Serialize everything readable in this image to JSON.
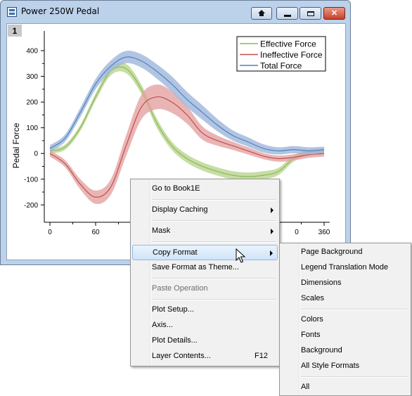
{
  "window": {
    "title": "Power 250W Pedal",
    "layer_number": "1"
  },
  "titlebar_buttons": {
    "home_icon": "home-icon",
    "minimize_icon": "minimize-icon",
    "maximize_icon": "maximize-icon",
    "close_icon": "close-icon"
  },
  "chart_data": {
    "type": "area",
    "ylabel": "Pedal Force",
    "xlabel": "",
    "xlim": [
      0,
      360
    ],
    "ylim": [
      -240,
      430
    ],
    "x_ticks_visible": [
      "0",
      "60",
      "0",
      "360"
    ],
    "y_ticks": [
      "400",
      "300",
      "200",
      "100",
      "0",
      "-100",
      "-200"
    ],
    "legend_position": "top-right",
    "series": [
      {
        "name": "Effective Force",
        "color": "#8db85a",
        "band_color": "#b9d48f",
        "x": [
          0,
          20,
          40,
          60,
          80,
          100,
          120,
          140,
          160,
          180,
          200,
          220,
          240,
          260,
          280,
          300,
          320,
          340,
          360
        ],
        "values": [
          10,
          25,
          100,
          220,
          320,
          330,
          250,
          120,
          30,
          -20,
          -50,
          -70,
          -85,
          -90,
          -85,
          -70,
          -20,
          5,
          10
        ],
        "band_half_width": [
          10,
          10,
          12,
          14,
          16,
          18,
          18,
          18,
          16,
          16,
          16,
          16,
          16,
          16,
          16,
          14,
          12,
          10,
          10
        ]
      },
      {
        "name": "Ineffective Force",
        "color": "#c0504d",
        "band_color": "#e3a3a1",
        "x": [
          0,
          20,
          40,
          60,
          80,
          100,
          120,
          140,
          160,
          180,
          200,
          220,
          240,
          260,
          280,
          300,
          320,
          340,
          360
        ],
        "values": [
          0,
          -40,
          -120,
          -170,
          -130,
          30,
          180,
          220,
          200,
          150,
          80,
          50,
          30,
          10,
          -10,
          -20,
          -15,
          -5,
          0
        ],
        "band_half_width": [
          12,
          14,
          20,
          26,
          30,
          40,
          48,
          48,
          42,
          34,
          26,
          20,
          16,
          14,
          12,
          12,
          12,
          12,
          12
        ]
      },
      {
        "name": "Total Force",
        "color": "#4f81bd",
        "band_color": "#9db7dc",
        "x": [
          0,
          20,
          40,
          60,
          80,
          100,
          120,
          140,
          160,
          180,
          200,
          220,
          240,
          260,
          280,
          300,
          320,
          340,
          360
        ],
        "values": [
          20,
          60,
          160,
          270,
          340,
          375,
          360,
          320,
          270,
          210,
          160,
          110,
          70,
          45,
          20,
          10,
          15,
          10,
          15
        ],
        "band_half_width": [
          12,
          14,
          18,
          20,
          22,
          24,
          26,
          28,
          30,
          30,
          28,
          24,
          20,
          18,
          16,
          14,
          14,
          14,
          12
        ]
      }
    ]
  },
  "context_menu": {
    "items": [
      {
        "label": "Go to Book1E"
      },
      {
        "label": "Display Caching"
      },
      {
        "label": "Mask"
      },
      {
        "label": "Copy Format"
      },
      {
        "label": "Save Format as Theme..."
      },
      {
        "label": "Paste Operation"
      },
      {
        "label": "Plot Setup..."
      },
      {
        "label": "Axis..."
      },
      {
        "label": "Plot Details..."
      },
      {
        "label": "Layer Contents...",
        "shortcut": "F12"
      }
    ]
  },
  "submenu": {
    "items": [
      {
        "label": "Page Background"
      },
      {
        "label": "Legend Translation Mode"
      },
      {
        "label": "Dimensions"
      },
      {
        "label": "Scales"
      },
      {
        "label": "Colors"
      },
      {
        "label": "Fonts"
      },
      {
        "label": "Background"
      },
      {
        "label": "All Style Formats"
      },
      {
        "label": "All"
      }
    ]
  },
  "cursor": {
    "icon": "arrow-cursor-icon"
  }
}
